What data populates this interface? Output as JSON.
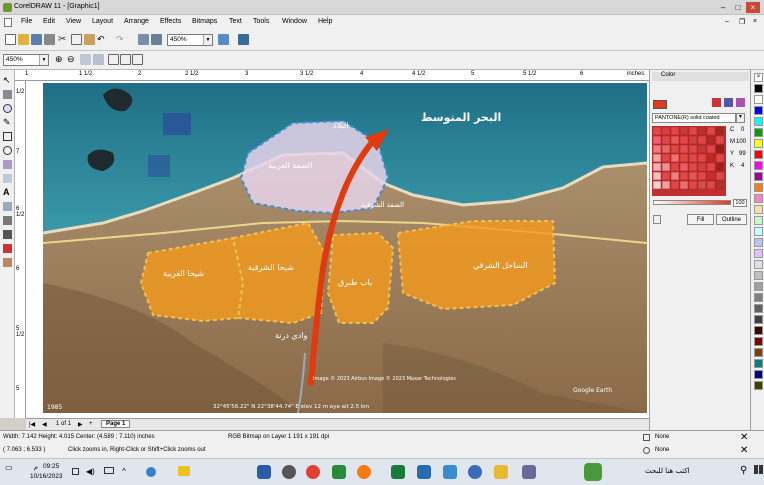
{
  "window": {
    "title": "CorelDRAW 11 - [Graphic1]"
  },
  "menu": {
    "items": [
      "File",
      "Edit",
      "View",
      "Layout",
      "Arrange",
      "Effects",
      "Bitmaps",
      "Text",
      "Tools",
      "Window",
      "Help"
    ]
  },
  "toolbar": {
    "zoom_value": "450%"
  },
  "property_bar": {
    "zoom_value": "450%"
  },
  "rulers": {
    "top": [
      "1",
      "1 1/2",
      "2",
      "2 1/2",
      "3",
      "3 1/2",
      "4",
      "4 1/2",
      "5",
      "5 1/2",
      "6"
    ],
    "unit": "inches",
    "left": [
      "1/2",
      "7",
      "6 1/2",
      "6",
      "5 1/2",
      "5"
    ]
  },
  "map": {
    "labels": {
      "sea": "البحر المتوسط",
      "balad": "البلاد",
      "west_ain": "الضفة الغربية",
      "east_ain": "الضفة الشرقية",
      "shiha_west": "شيحا الغربية",
      "shiha_east": "شيحا الشرقية",
      "bab_tobruk": "باب طبرق",
      "east_coast": "الساحل الشرقي",
      "wadi": "وادي درنة"
    },
    "footer_left": "1985",
    "footer_mid": "32°45'56.22\" N  22°38'44.74\" E   elev 12 m   eye alt 2.5 km",
    "footer_right": "Google Earth",
    "credits": "Image © 2023 Airbus  Image © 2023 Maxar Technologies",
    "colors": {
      "zone_fill": "#f39a1e",
      "zone_border": "#f0c050",
      "old_zone": "#e6d4ea",
      "old_border": "#3b8fd6",
      "river": "#e03a10",
      "sea": "#2a7f93"
    }
  },
  "page_nav": {
    "counter": "1 of 1",
    "tab": "Page 1"
  },
  "color_panel": {
    "title": "Color",
    "palette_name": "PANTONE(R) solid coated",
    "c_label": "C",
    "c_value": "0",
    "m_label": "M",
    "m_value": "100",
    "y_label": "Y",
    "y_value": "99",
    "k_label": "K",
    "k_value": "4",
    "tint_value": "100",
    "fill_button": "Fill",
    "outline_button": "Outline"
  },
  "status": {
    "dimensions": "Width: 7.142  Height: 4.015  Center: (4.589 ; 7.110)  inches",
    "object": "RGB Bitmap on Layer 1 191 x 191 dpi",
    "coords": "( 7.063 ; 6.533 )",
    "hint": "Click zooms in, Right-Click or Shift+Click zooms out",
    "fill": "None",
    "outline": "None"
  },
  "taskbar": {
    "time": "09:25",
    "time_suffix": "م",
    "date": "10/16/2023",
    "search_placeholder": "اكتب هنا للبحث"
  }
}
